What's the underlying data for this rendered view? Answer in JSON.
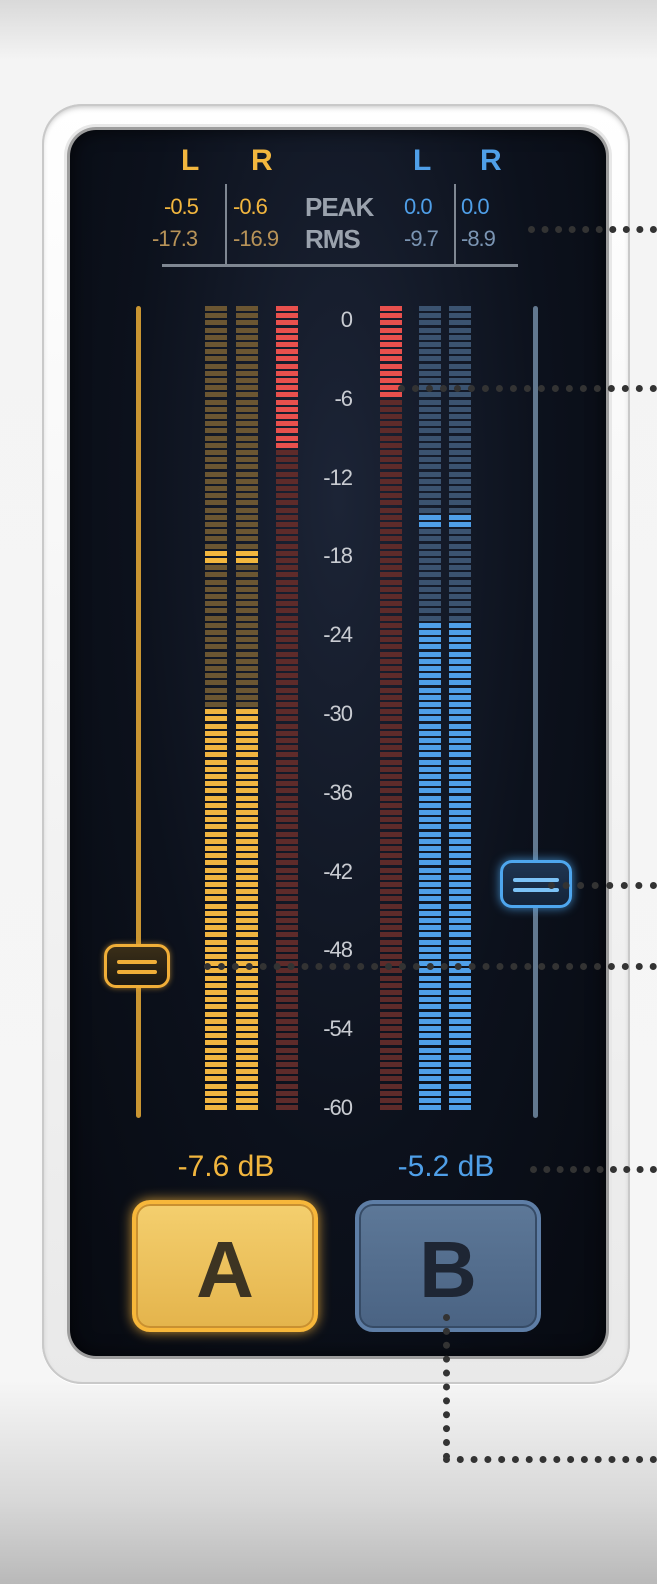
{
  "meter": {
    "headers": {
      "a_left": "L",
      "a_right": "R",
      "b_left": "L",
      "b_right": "R"
    },
    "peak_label": "PEAK",
    "rms_label": "RMS",
    "a_peak_left": "-0.5",
    "a_peak_right": "-0.6",
    "a_rms_left": "-17.3",
    "a_rms_right": "-16.9",
    "b_peak_left": "0.0",
    "b_peak_right": "0.0",
    "b_rms_left": "-9.7",
    "b_rms_right": "-8.9",
    "scale": [
      "0",
      "-6",
      "-12",
      "-18",
      "-24",
      "-30",
      "-36",
      "-42",
      "-48",
      "-54",
      "-60"
    ],
    "scale_range_db": [
      -60,
      0
    ],
    "a_level_db": -30,
    "a_hold_db": -18.5,
    "a_reduction_to_db": -10.5,
    "b_level_db": -23.5,
    "b_hold_db": -16,
    "b_reduction_to_db": -6.5
  },
  "faders": {
    "a_gain_db": -7.6,
    "b_gain_db": -5.2,
    "a_gain_label": "-7.6 dB",
    "b_gain_label": "-5.2 dB"
  },
  "buttons": {
    "a_label": "A",
    "b_label": "B"
  },
  "colors": {
    "a_accent": "#f2b63e",
    "b_accent": "#4f9fe8",
    "reduction_red": "#e8504d",
    "panel_bg": "#0c111c"
  }
}
